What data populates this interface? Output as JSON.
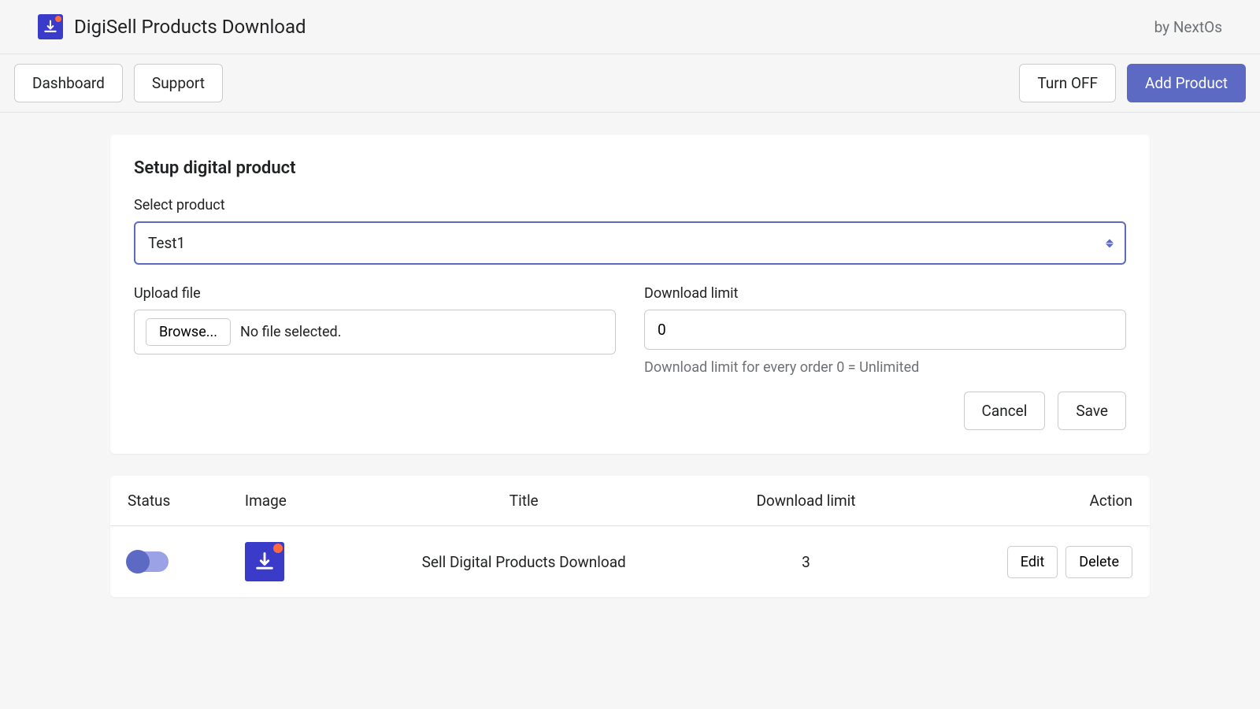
{
  "header": {
    "app_title": "DigiSell Products Download",
    "by_text": "by NextOs"
  },
  "toolbar": {
    "dashboard": "Dashboard",
    "support": "Support",
    "turn_off": "Turn OFF",
    "add_product": "Add Product"
  },
  "setup": {
    "title": "Setup digital product",
    "select_product_label": "Select product",
    "select_product_value": "Test1",
    "upload_file_label": "Upload file",
    "browse_label": "Browse...",
    "file_status": "No file selected.",
    "download_limit_label": "Download limit",
    "download_limit_value": "0",
    "download_limit_help": "Download limit for every order 0 = Unlimited",
    "cancel": "Cancel",
    "save": "Save"
  },
  "table": {
    "headers": {
      "status": "Status",
      "image": "Image",
      "title": "Title",
      "download_limit": "Download limit",
      "action": "Action"
    },
    "rows": [
      {
        "title": "Sell Digital Products Download",
        "download_limit": "3",
        "edit": "Edit",
        "delete": "Delete"
      }
    ]
  }
}
